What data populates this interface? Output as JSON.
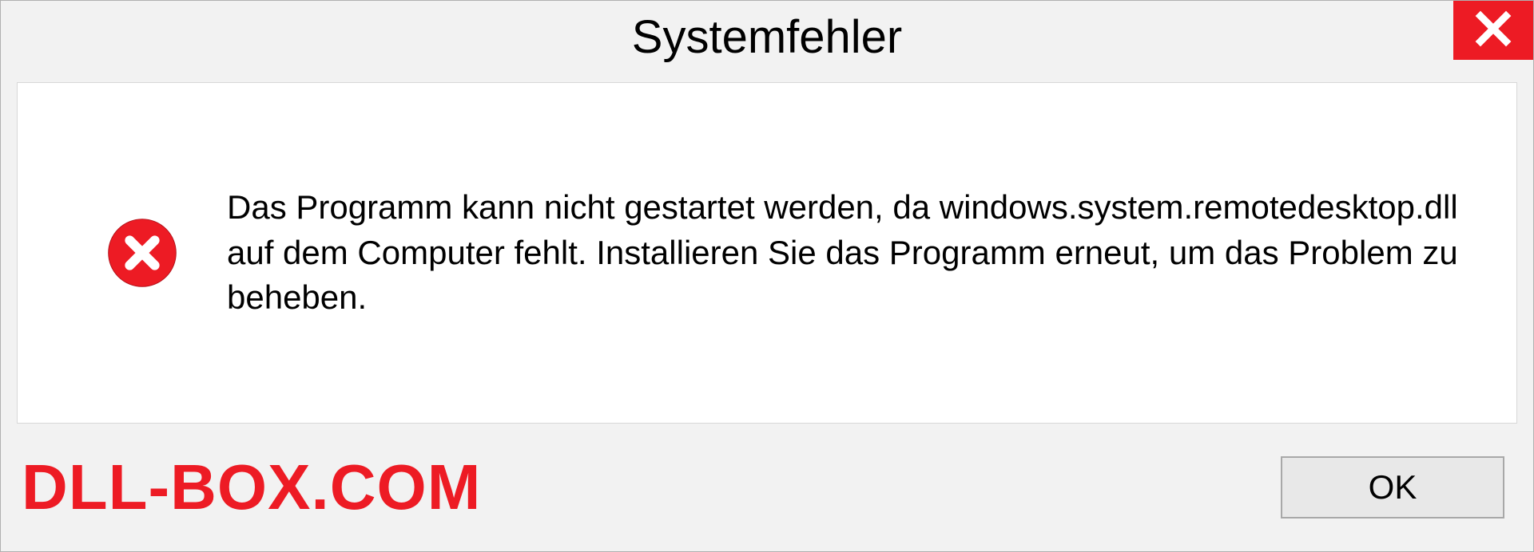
{
  "dialog": {
    "title": "Systemfehler",
    "message": "Das Programm kann nicht gestartet werden, da windows.system.remotedesktop.dll auf dem Computer fehlt. Installieren Sie das Programm erneut, um das Problem zu beheben.",
    "ok_label": "OK"
  },
  "watermark": "DLL-BOX.COM"
}
